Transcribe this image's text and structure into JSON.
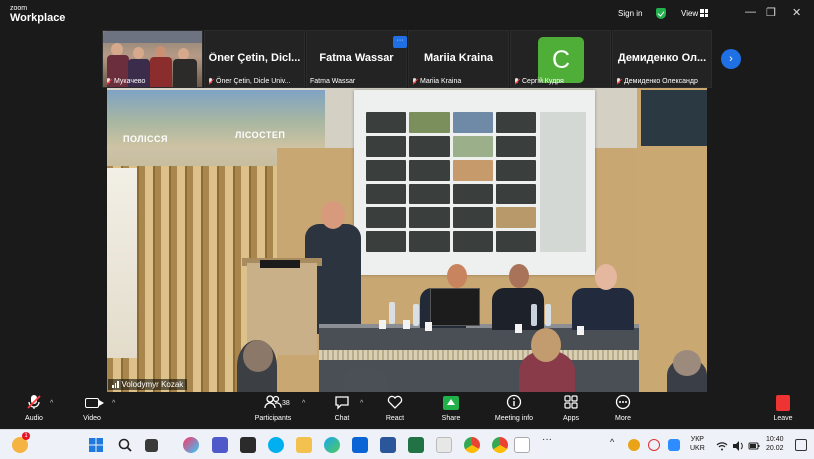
{
  "app": {
    "logo_line1": "zoom",
    "logo_line2": "Workplace",
    "signin_label": "Sign in",
    "view_label": "View",
    "accent": "#1f6fe5",
    "shield_color": "#22b14c"
  },
  "window_controls": {
    "minimize": "—",
    "restore": "❐",
    "close": "✕"
  },
  "participants": [
    {
      "display_name": "Мукачево",
      "big_name": "",
      "muted": true,
      "video": true
    },
    {
      "display_name": "Öner Çetin, Dicle Univ...",
      "big_name": "Öner Çetin, Dicl...",
      "muted": true,
      "video": false
    },
    {
      "display_name": "Fatma Wassar",
      "big_name": "Fatma Wassar",
      "muted": false,
      "video": false
    },
    {
      "display_name": "Mariia Kraina",
      "big_name": "Mariia Kraina",
      "muted": true,
      "video": false
    },
    {
      "display_name": "Сергій Кудря",
      "big_name": "",
      "muted": true,
      "video": false,
      "avatar_letter": "C",
      "avatar_color": "#4fae37"
    },
    {
      "display_name": "Демиденко Олександр",
      "big_name": "Демиденко Ол...",
      "muted": true,
      "video": false
    }
  ],
  "strip_more": "···",
  "strip_next": "›",
  "main_video": {
    "speaker_name": "Volodymyr Kozak",
    "banner_text_1": "ПОЛІССЯ",
    "banner_text_2": "ЛІСОСТЕП"
  },
  "toolbar": {
    "audio": "Audio",
    "video": "Video",
    "participants": "Participants",
    "participants_count": "38",
    "chat": "Chat",
    "react": "React",
    "share": "Share",
    "meeting_info": "Meeting info",
    "apps": "Apps",
    "more": "More",
    "leave": "Leave",
    "caret": "^"
  },
  "taskbar": {
    "notification_count": "1",
    "language_line1": "УКР",
    "language_line2": "UKR",
    "time": "10:40",
    "date": "20.02",
    "overflow": "^",
    "more_apps": "···"
  }
}
